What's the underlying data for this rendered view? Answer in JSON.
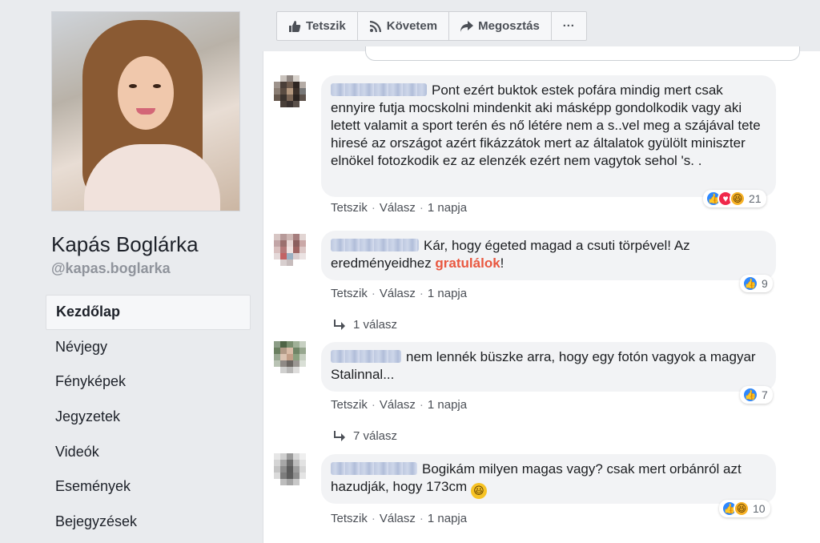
{
  "page": {
    "name": "Kapás Boglárka",
    "handle": "@kapas.boglarka"
  },
  "nav": {
    "items": [
      {
        "label": "Kezdőlap",
        "active": true
      },
      {
        "label": "Névjegy",
        "active": false
      },
      {
        "label": "Fényképek",
        "active": false
      },
      {
        "label": "Jegyzetek",
        "active": false
      },
      {
        "label": "Videók",
        "active": false
      },
      {
        "label": "Események",
        "active": false
      },
      {
        "label": "Bejegyzések",
        "active": false
      }
    ]
  },
  "actionbar": {
    "like": "Tetszik",
    "follow": "Követem",
    "share": "Megosztás",
    "more": "···"
  },
  "comments": [
    {
      "text": "Pont ezért buktok estek pofára mindig mert csak ennyire futja mocskolni mindenkit aki másképp gondolkodik vagy aki letett valamit a sport terén és nő létére nem a s..vel meg a szájával tete hiresé az országot azért fikázzátok mert az általatok gyülölt miniszter elnökel fotozkodik ez az elenzék ezért nem vagytok sehol 's. .",
      "reaction_count": "21",
      "reactions": [
        "like",
        "love",
        "haha"
      ],
      "like_label": "Tetszik",
      "reply_label": "Válasz",
      "time": "1 napja"
    },
    {
      "text_before": "Kár, hogy égeted magad a csuti törpével! Az eredményeidhez ",
      "text_highlight": "gratulálok",
      "text_after": "!",
      "reaction_count": "9",
      "reactions": [
        "like"
      ],
      "like_label": "Tetszik",
      "reply_label": "Válasz",
      "time": "1 napja",
      "replies": "1 válasz"
    },
    {
      "text": "nem lennék büszke arra, hogy egy fotón vagyok a magyar Stalinnal...",
      "reaction_count": "7",
      "reactions": [
        "like"
      ],
      "like_label": "Tetszik",
      "reply_label": "Válasz",
      "time": "1 napja",
      "replies": "7 válasz"
    },
    {
      "text": "Bogikám milyen magas vagy? csak mert orbánról azt hazudják, hogy 173cm",
      "reaction_count": "10",
      "reactions": [
        "like",
        "haha"
      ],
      "like_label": "Tetszik",
      "reply_label": "Válasz",
      "time": "1 napja"
    }
  ],
  "colors": {
    "accent": "#4267b2",
    "highlight": "#e9573f",
    "background": "#e9ebee",
    "bubble": "#f2f3f5"
  }
}
